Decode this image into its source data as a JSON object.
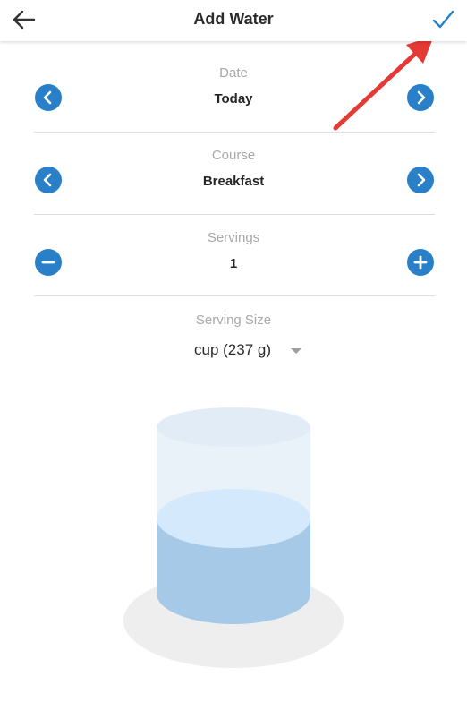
{
  "header": {
    "title": "Add Water",
    "back_icon": "arrow-left-icon",
    "save_icon": "checkmark-icon"
  },
  "date": {
    "label": "Date",
    "value": "Today"
  },
  "course": {
    "label": "Course",
    "value": "Breakfast"
  },
  "servings": {
    "label": "Servings",
    "value": "1"
  },
  "serving_size": {
    "label": "Serving Size",
    "value": "cup (237 g)"
  },
  "colors": {
    "accent_blue": "#2980c8",
    "annotation_red": "#e53935",
    "water_top": "#d4e9fb",
    "water_side": "#a7c9e8"
  }
}
